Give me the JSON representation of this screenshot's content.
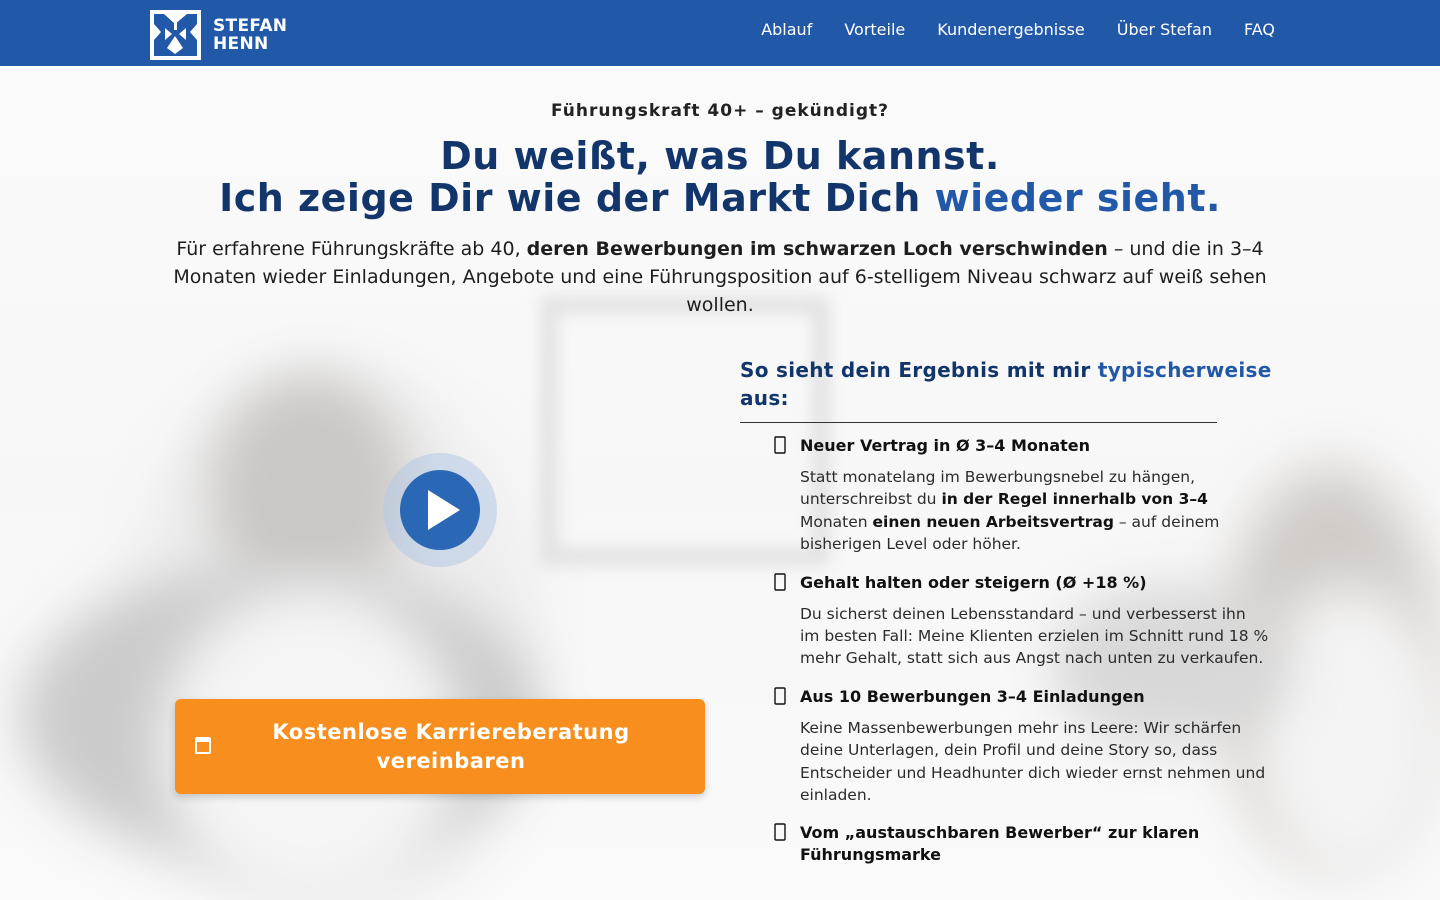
{
  "header": {
    "logo_line1": "STEFAN",
    "logo_line2": "HENN",
    "nav": [
      {
        "label": "Ablauf"
      },
      {
        "label": "Vorteile"
      },
      {
        "label": "Kundenergebnisse"
      },
      {
        "label": "Über Stefan"
      },
      {
        "label": "FAQ"
      }
    ],
    "colors": {
      "bar": "#2258a8"
    }
  },
  "hero": {
    "eyebrow": "Führungskraft 40+ – gekündigt?",
    "headline_line1": "Du weißt, was Du kannst.",
    "headline_line2_a": "Ich zeige Dir wie der Markt Dich ",
    "headline_line2_b": "wieder sieht.",
    "lead_a": "Für erfahrene Führungskräfte ab 40, ",
    "lead_b": "deren Bewerbungen im schwarzen Loch verschwinden",
    "lead_c": " – und die in 3–4 Monaten wieder Einladungen, Angebote und eine Führungsposition auf 6-stelligem Niveau schwarz auf weiß sehen wollen."
  },
  "video": {
    "icon": "play-icon"
  },
  "cta": {
    "icon": "calendar-icon",
    "label": "Kostenlose Karriereberatung vereinbaren",
    "color": "#f78e1e"
  },
  "results": {
    "title_a": "So sieht dein Ergebnis mit mir ",
    "title_b": "typischerweise",
    "title_c": " aus:",
    "items": [
      {
        "icon": "check-icon",
        "title": "Neuer Vertrag in Ø 3–4 Monaten",
        "t1": "Statt monatelang im Bewerbungsnebel zu hängen, unterschreibst du ",
        "b1": "in der Regel innerhalb von 3–4",
        "t2": " Monaten ",
        "b2": "einen neuen Arbeitsvertrag",
        "t3": " – auf deinem bisherigen Level oder höher."
      },
      {
        "icon": "check-icon",
        "title": "Gehalt halten oder steigern (Ø +18 %)",
        "text": "Du sicherst deinen Lebensstandard – und verbesserst ihn im besten Fall: Meine Klienten erzielen im Schnitt rund 18 % mehr Gehalt, statt sich aus Angst nach unten zu verkaufen."
      },
      {
        "icon": "check-icon",
        "title": "Aus 10 Bewerbungen 3–4 Einladungen",
        "text": "Keine Massenbewerbungen mehr ins Leere: Wir schärfen deine Unterlagen, dein Profil und deine Story so, dass Entscheider und Headhunter dich wieder ernst nehmen und einladen."
      },
      {
        "icon": "check-icon",
        "title": "Vom „austauschbaren Bewerber“ zur klaren Führungsmarke"
      }
    ]
  }
}
